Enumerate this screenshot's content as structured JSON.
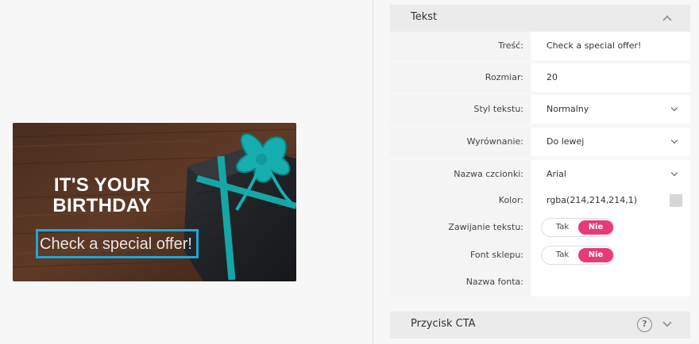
{
  "banner": {
    "headline_line1": "IT'S YOUR",
    "headline_line2": "BIRTHDAY",
    "offer_text": "Check a special offer!",
    "accent_color": "#1ea7d6"
  },
  "panel": {
    "text_section": {
      "title": "Tekst",
      "icon": "chevron-up-icon"
    },
    "cta_section": {
      "title": "Przycisk CTA",
      "help_icon": "question-icon",
      "icon": "chevron-down-icon"
    },
    "rows": {
      "content": {
        "label": "Treść:",
        "value": "Check a special offer!"
      },
      "size": {
        "label": "Rozmiar:",
        "value": "20"
      },
      "style": {
        "label": "Styl tekstu:",
        "value": "Normalny"
      },
      "align": {
        "label": "Wyrównanie:",
        "value": "Do lewej"
      },
      "font_name": {
        "label": "Nazwa czcionki:",
        "value": "Arial"
      },
      "color": {
        "label": "Kolor:",
        "value": "rgba(214,214,214,1)",
        "swatch": "#d6d6d6"
      },
      "wrap": {
        "label": "Zawijanie tekstu:",
        "off_label": "Tak",
        "on_label": "Nie"
      },
      "store_font": {
        "label": "Font sklepu:",
        "off_label": "Tak",
        "on_label": "Nie"
      },
      "font_label": {
        "label": "Nazwa fonta:",
        "value": ""
      }
    },
    "toggle_color": "#e83a73"
  }
}
